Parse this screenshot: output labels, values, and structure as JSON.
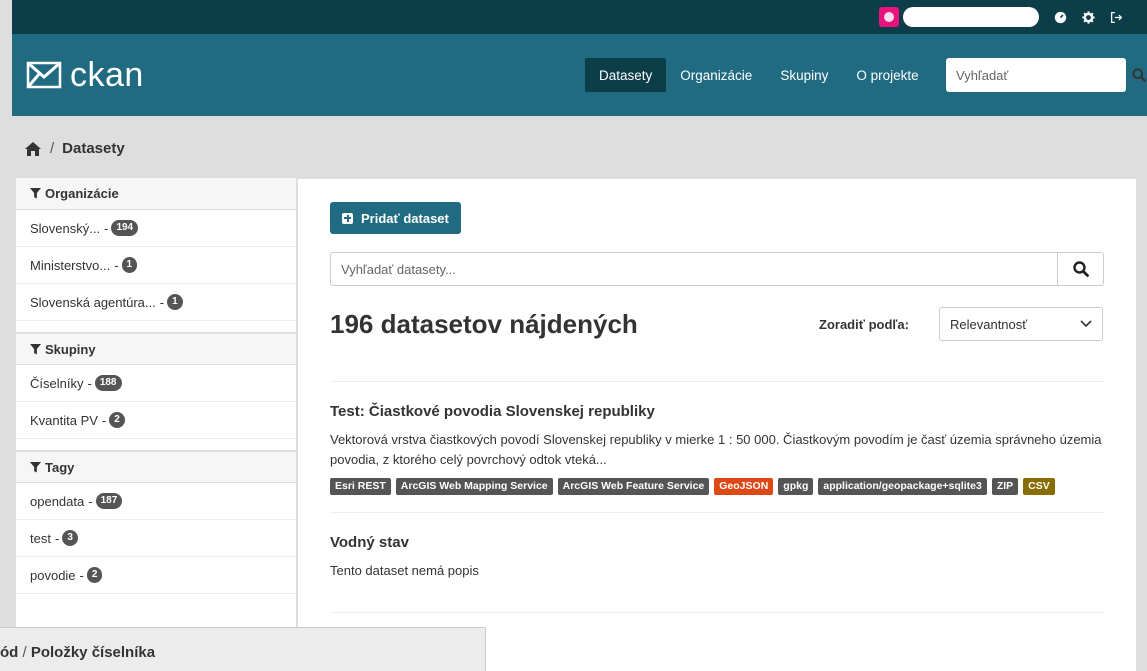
{
  "account": {
    "avatar_color": "#e8137c",
    "icons": [
      "dashboard-icon",
      "gear-icon",
      "logout-icon"
    ]
  },
  "masthead": {
    "logo_text": "ckan",
    "nav": [
      {
        "label": "Datasety",
        "active": true
      },
      {
        "label": "Organizácie",
        "active": false
      },
      {
        "label": "Skupiny",
        "active": false
      },
      {
        "label": "O projekte",
        "active": false
      }
    ],
    "search_placeholder": "Vyhľadať",
    "colors": {
      "masthead": "#206b82",
      "account_bar": "#0c3e4a"
    }
  },
  "breadcrumb": {
    "current": "Datasety"
  },
  "sidebar": {
    "organizations": {
      "heading": "Organizácie",
      "items": [
        {
          "label": "Slovenský...",
          "count": "194"
        },
        {
          "label": "Ministerstvo...",
          "count": "1"
        },
        {
          "label": "Slovenská agentúra...",
          "count": "1"
        }
      ]
    },
    "groups": {
      "heading": "Skupiny",
      "items": [
        {
          "label": "Číselníky",
          "count": "188"
        },
        {
          "label": "Kvantita PV",
          "count": "2"
        }
      ]
    },
    "tags": {
      "heading": "Tagy",
      "items": [
        {
          "label": "opendata",
          "count": "187"
        },
        {
          "label": "test",
          "count": "3"
        },
        {
          "label": "povodie",
          "count": "2"
        }
      ]
    }
  },
  "main": {
    "add_button": "Pridať dataset",
    "search_placeholder": "Vyhľadať datasety...",
    "results_title": "196 datasetov nájdených",
    "sort_label": "Zoradiť podľa:",
    "sort_value": "Relevantnosť",
    "datasets": [
      {
        "title": "Test: Čiastkové povodia Slovenskej republiky",
        "notes": "Vektorová vrstva čiastkových povodí Slovenskej republiky v mierke 1 : 50 000. Čiastkovým povodím je časť územia správneho územia povodia, z ktorého celý povrchový odtok vteká...",
        "formats": [
          {
            "label": "Esri REST",
            "color": "#555555"
          },
          {
            "label": "ArcGIS Web Mapping Service",
            "color": "#555555"
          },
          {
            "label": "ArcGIS Web Feature Service",
            "color": "#555555"
          },
          {
            "label": "GeoJSON",
            "color": "#dd4814"
          },
          {
            "label": "gpkg",
            "color": "#555555"
          },
          {
            "label": "application/geopackage+sqlite3",
            "color": "#555555"
          },
          {
            "label": "ZIP",
            "color": "#555555"
          },
          {
            "label": "CSV",
            "color": "#8a6d00"
          }
        ]
      },
      {
        "title": "Vodný stav",
        "notes": "Tento dataset nemá popis",
        "formats": []
      }
    ]
  },
  "overlay": {
    "partial": "ód",
    "current": "Položky číselníka"
  }
}
